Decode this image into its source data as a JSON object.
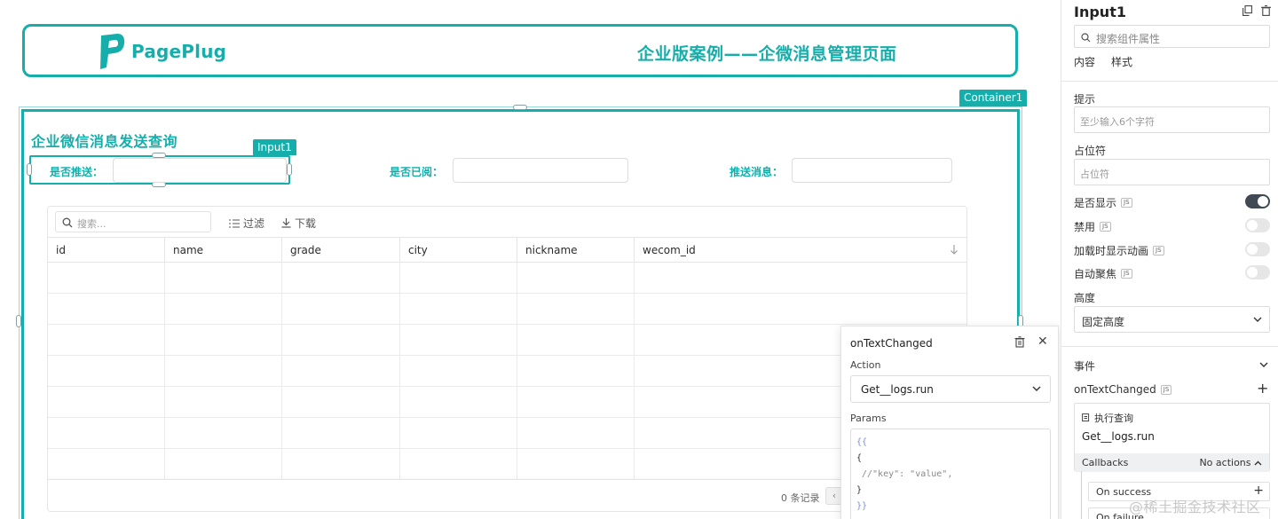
{
  "canvas": {
    "brand": "PagePlug",
    "header_title": "企业版案例——企微消息管理页面",
    "container_tag": "Container1",
    "section_title": "企业微信消息发送查询",
    "input1_tag": "Input1",
    "fields": [
      {
        "label": "是否推送："
      },
      {
        "label": "是否已阅："
      },
      {
        "label": "推送消息："
      }
    ]
  },
  "table": {
    "search_placeholder": "搜索...",
    "filter_label": "过滤",
    "download_label": "下载",
    "columns": [
      "id",
      "name",
      "grade",
      "city",
      "nickname",
      "wecom_id"
    ],
    "records_text": "0 条记录",
    "prev_page": "‹"
  },
  "popup": {
    "title": "onTextChanged",
    "action_label": "Action",
    "action_value": "Get__logs.run",
    "params_label": "Params",
    "code_lines": [
      "{{",
      "{",
      "//\"key\": \"value\",",
      "}",
      "}}"
    ]
  },
  "panel": {
    "widget_name": "Input1",
    "search_placeholder": "搜索组件属性",
    "tabs": [
      "内容",
      "样式"
    ],
    "hint_label": "提示",
    "hint_value": "至少输入6个字符",
    "placeholder_label": "占位符",
    "placeholder_value": "占位符",
    "visible_label": "是否显示",
    "disabled_label": "禁用",
    "animate_label": "加载时显示动画",
    "autofocus_label": "自动聚焦",
    "js_badge": "JS",
    "height_label": "高度",
    "height_value": "固定高度",
    "events_label": "事件",
    "event_name": "onTextChanged",
    "query_label": "执行查询",
    "query_value": "Get__logs.run",
    "callbacks_label": "Callbacks",
    "no_actions": "No actions",
    "on_success": "On success",
    "on_failure": "On failure",
    "toggles": {
      "visible": true,
      "disabled": false,
      "animate": false,
      "autofocus": false
    }
  },
  "watermark": "@稀土掘金技术社区",
  "colors": {
    "brand": "#16aeab",
    "toggle_on": "#3f4a55"
  }
}
